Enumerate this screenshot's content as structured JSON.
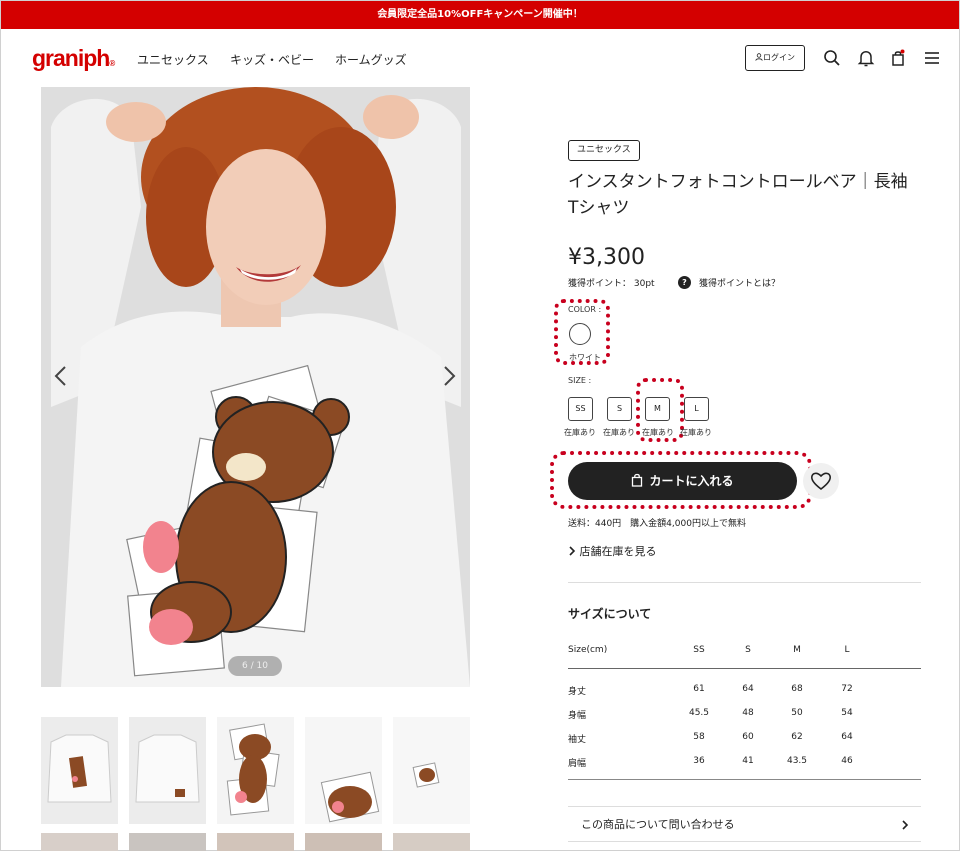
{
  "banner": {
    "text": "会員限定全品10%OFFキャンペーン開催中！"
  },
  "header": {
    "logo": "graniph",
    "logo_mark": "®",
    "nav": [
      "ユニセックス",
      "キッズ・ベビー",
      "ホームグッズ"
    ],
    "login_label": "ログイン"
  },
  "gallery": {
    "counter": "6 / 10"
  },
  "product": {
    "tag": "ユニセックス",
    "title": "インスタントフォトコントロールベア｜長袖Tシャツ",
    "price": "¥3,300",
    "points": "獲得ポイント： 30pt",
    "points_help": "獲得ポイントとは？",
    "color_label": "COLOR :",
    "color_name": "ホワイト",
    "size_label": "SIZE :",
    "sizes": [
      {
        "label": "SS",
        "stock": "在庫あり"
      },
      {
        "label": "S",
        "stock": "在庫あり"
      },
      {
        "label": "M",
        "stock": "在庫あり"
      },
      {
        "label": "L",
        "stock": "在庫あり"
      }
    ],
    "cart_label": "カートに入れる",
    "shipping": "送料：440円　購入金額4,000円以上で無料",
    "store_stock": "店舗在庫を見る"
  },
  "size_table": {
    "heading": "サイズについて",
    "columns": [
      "Size(cm)",
      "SS",
      "S",
      "M",
      "L"
    ],
    "rows": [
      {
        "label": "身丈",
        "values": [
          "61",
          "64",
          "68",
          "72"
        ]
      },
      {
        "label": "身幅",
        "values": [
          "45.5",
          "48",
          "50",
          "54"
        ]
      },
      {
        "label": "袖丈",
        "values": [
          "58",
          "60",
          "62",
          "64"
        ]
      },
      {
        "label": "肩幅",
        "values": [
          "36",
          "41",
          "43.5",
          "46"
        ]
      }
    ]
  },
  "inquiry": {
    "label": "この商品について問い合わせる"
  },
  "colors": {
    "brand": "#d40000",
    "highlight": "#c8001e",
    "button": "#222222"
  }
}
